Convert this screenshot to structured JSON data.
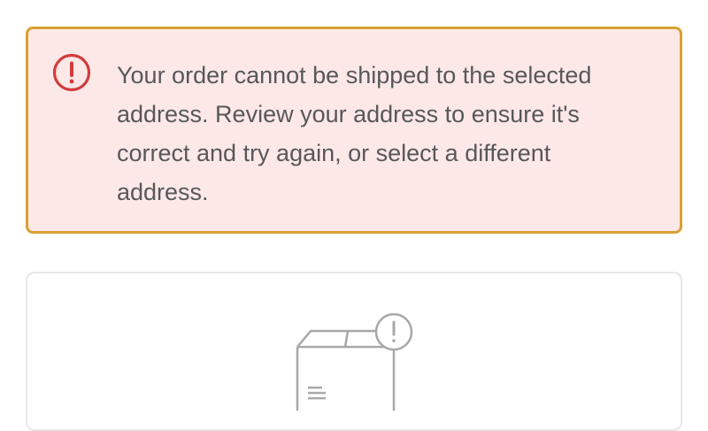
{
  "alert": {
    "message": "Your order cannot be shipped to the selected address. Review your address to ensure it's correct and try again, or select a different address.",
    "icon": "exclamation-circle-icon",
    "background_color": "#fde8e8",
    "border_color": "#d9a032",
    "icon_color": "#d13c3c"
  },
  "empty_state": {
    "icon": "package-warning-icon",
    "icon_color": "#a8a8a8"
  }
}
